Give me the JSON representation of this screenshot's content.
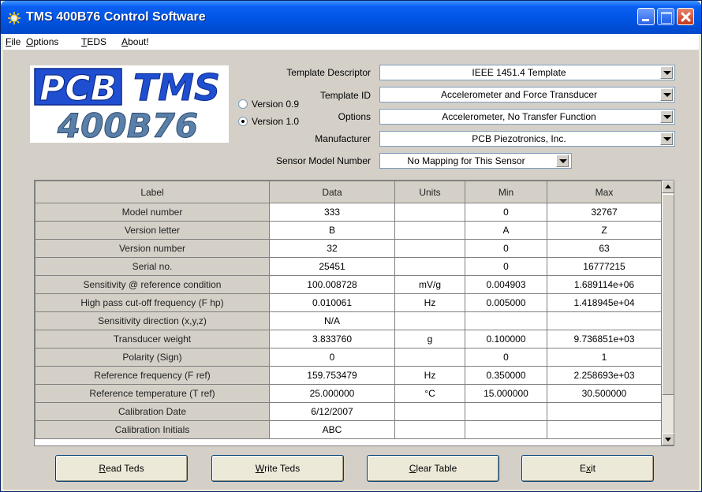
{
  "window": {
    "title": "TMS 400B76 Control Software"
  },
  "menu": [
    {
      "underline": "F",
      "rest": "ile"
    },
    {
      "underline": "O",
      "rest": "ptions"
    },
    {
      "underline": "T",
      "rest": "EDS"
    },
    {
      "underline": "A",
      "rest": "bout!"
    }
  ],
  "logo": {
    "line1_left": "PCB",
    "line1_right": "TMS",
    "line2": "400B76"
  },
  "radios": [
    {
      "label": "Version 0.9",
      "checked": false
    },
    {
      "label": "Version 1.0",
      "checked": true
    }
  ],
  "fields": {
    "template_descriptor": {
      "label": "Template Descriptor",
      "value": "IEEE 1451.4 Template"
    },
    "template_id": {
      "label": "Template ID",
      "value": "Accelerometer and Force Transducer"
    },
    "options": {
      "label": "Options",
      "value": "Accelerometer, No Transfer Function"
    },
    "manufacturer": {
      "label": "Manufacturer",
      "value": "PCB Piezotronics, Inc."
    },
    "sensor_model": {
      "label": "Sensor Model Number",
      "value": "No Mapping for This Sensor"
    }
  },
  "table": {
    "headers": [
      "Label",
      "Data",
      "Units",
      "Min",
      "Max"
    ],
    "rows": [
      [
        "Model number",
        "333",
        "",
        "0",
        "32767"
      ],
      [
        "Version letter",
        "B",
        "",
        "A",
        "Z"
      ],
      [
        "Version number",
        "32",
        "",
        "0",
        "63"
      ],
      [
        "Serial no.",
        "25451",
        "",
        "0",
        "16777215"
      ],
      [
        "Sensitivity @ reference condition",
        "100.008728",
        "mV/g",
        "0.004903",
        "1.689114e+06"
      ],
      [
        "High pass cut-off frequency (F hp)",
        "0.010061",
        "Hz",
        "0.005000",
        "1.418945e+04"
      ],
      [
        "Sensitivity direction (x,y,z)",
        "N/A",
        "",
        "",
        ""
      ],
      [
        "Transducer weight",
        "3.833760",
        "g",
        "0.100000",
        "9.736851e+03"
      ],
      [
        "Polarity (Sign)",
        "0",
        "",
        "0",
        "1"
      ],
      [
        "Reference frequency (F ref)",
        "159.753479",
        "Hz",
        "0.350000",
        "2.258693e+03"
      ],
      [
        "Reference temperature (T ref)",
        "25.000000",
        "°C",
        "15.000000",
        "30.500000"
      ],
      [
        "Calibration Date",
        "6/12/2007",
        "",
        "",
        ""
      ],
      [
        "Calibration Initials",
        "ABC",
        "",
        "",
        ""
      ]
    ]
  },
  "buttons": [
    {
      "name": "read-teds-button",
      "underline": "R",
      "rest": "ead Teds"
    },
    {
      "name": "write-teds-button",
      "underline": "W",
      "rest": "rite Teds"
    },
    {
      "name": "clear-table-button",
      "underline": "C",
      "rest": "lear Table"
    },
    {
      "name": "exit-button",
      "prefix": "E",
      "underline": "x",
      "rest": "it"
    }
  ],
  "colors": {
    "titlebar": "#0055e5",
    "logo_blue": "#1f4fd0",
    "logo_steel": "#5a7fa8"
  }
}
